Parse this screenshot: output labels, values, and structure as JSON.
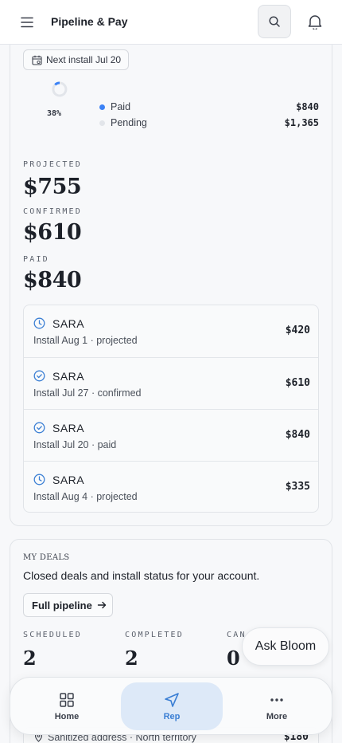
{
  "header": {
    "title": "Pipeline & Pay",
    "icons": [
      "menu-icon",
      "search-icon",
      "bell-icon"
    ]
  },
  "earnings": {
    "next_install": "Next install Jul 20",
    "donut_percent_label": "38%",
    "paid_fraction": 0.38,
    "legend": [
      {
        "label": "Paid",
        "value": "$840",
        "color": "#3b82f6"
      },
      {
        "label": "Pending",
        "value": "$1,365",
        "color": "#e2e5ea"
      }
    ],
    "stats": [
      {
        "label": "PROJECTED",
        "value": "$755"
      },
      {
        "label": "CONFIRMED",
        "value": "$610"
      },
      {
        "label": "PAID",
        "value": "$840"
      }
    ],
    "installs": [
      {
        "name": "SARA",
        "detail": "Install Aug 1 · projected",
        "amount": "$420",
        "icon": "clock-icon"
      },
      {
        "name": "SARA",
        "detail": "Install Jul 27 · confirmed",
        "amount": "$610",
        "icon": "check-circle-icon"
      },
      {
        "name": "SARA",
        "detail": "Install Jul 20 · paid",
        "amount": "$840",
        "icon": "check-circle-icon"
      },
      {
        "name": "SARA",
        "detail": "Install Aug 4 · projected",
        "amount": "$335",
        "icon": "clock-icon"
      }
    ]
  },
  "deals": {
    "title": "MY DEALS",
    "description": "Closed deals and install status for your account.",
    "full_pipeline_label": "Full pipeline",
    "stats": [
      {
        "label": "SCHEDULED",
        "value": "2"
      },
      {
        "label": "COMPLETED",
        "value": "2"
      },
      {
        "label": "CAN",
        "value": "0"
      }
    ],
    "row_peek": {
      "text": "Sanitized address · North territory",
      "amount": "$180"
    }
  },
  "ask_bloom": "Ask Bloom",
  "bottom_nav": [
    {
      "label": "Home",
      "icon": "grid-icon"
    },
    {
      "label": "Rep",
      "icon": "navigation-icon",
      "active": true
    },
    {
      "label": "More",
      "icon": "more-icon"
    }
  ],
  "colors": {
    "accent": "#3b7fd4",
    "accent_bg": "#dde9f8"
  }
}
